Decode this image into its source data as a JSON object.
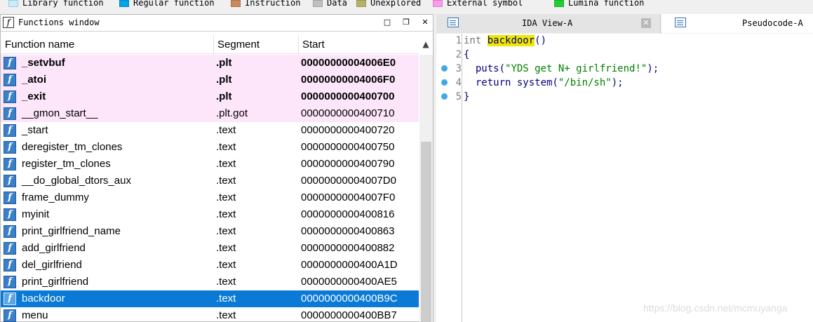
{
  "legend": [
    {
      "label": "Library function",
      "color": "#c8ecfa"
    },
    {
      "label": "Regular function",
      "color": "#00a2e8"
    },
    {
      "label": "Instruction",
      "color": "#c8895e"
    },
    {
      "label": "Data",
      "color": "#c0c0c0"
    },
    {
      "label": "Unexplored",
      "color": "#b4b468"
    },
    {
      "label": "External symbol",
      "color": "#ff99ee"
    },
    {
      "label": "Lumina function",
      "color": "#22cc33"
    }
  ],
  "functions_window": {
    "title": "Functions window",
    "title_icon": "f",
    "columns": {
      "name": "Function name",
      "segment": "Segment",
      "start": "Start"
    },
    "rows": [
      {
        "name": "_setvbuf",
        "segment": ".plt",
        "start": "00000000004006E0",
        "style": "lib bold"
      },
      {
        "name": "_atoi",
        "segment": ".plt",
        "start": "00000000004006F0",
        "style": "lib bold"
      },
      {
        "name": "_exit",
        "segment": ".plt",
        "start": "0000000000400700",
        "style": "lib bold"
      },
      {
        "name": "__gmon_start__",
        "segment": ".plt.got",
        "start": "0000000000400710",
        "style": "lib"
      },
      {
        "name": "_start",
        "segment": ".text",
        "start": "0000000000400720",
        "style": ""
      },
      {
        "name": "deregister_tm_clones",
        "segment": ".text",
        "start": "0000000000400750",
        "style": ""
      },
      {
        "name": "register_tm_clones",
        "segment": ".text",
        "start": "0000000000400790",
        "style": ""
      },
      {
        "name": "__do_global_dtors_aux",
        "segment": ".text",
        "start": "00000000004007D0",
        "style": ""
      },
      {
        "name": "frame_dummy",
        "segment": ".text",
        "start": "00000000004007F0",
        "style": ""
      },
      {
        "name": "myinit",
        "segment": ".text",
        "start": "0000000000400816",
        "style": ""
      },
      {
        "name": "print_girlfriend_name",
        "segment": ".text",
        "start": "0000000000400863",
        "style": ""
      },
      {
        "name": "add_girlfriend",
        "segment": ".text",
        "start": "0000000000400882",
        "style": ""
      },
      {
        "name": "del_girlfriend",
        "segment": ".text",
        "start": "0000000000400A1D",
        "style": ""
      },
      {
        "name": "print_girlfriend",
        "segment": ".text",
        "start": "0000000000400AE5",
        "style": ""
      },
      {
        "name": "backdoor",
        "segment": ".text",
        "start": "0000000000400B9C",
        "style": "sel"
      },
      {
        "name": "menu",
        "segment": ".text",
        "start": "0000000000400BB7",
        "style": ""
      }
    ]
  },
  "tabs": [
    {
      "label": "IDA View-A",
      "close": "✕"
    },
    {
      "label": "Pseudocode-A"
    }
  ],
  "code": {
    "line_numbers": [
      "1",
      "2",
      "3",
      "4",
      "5"
    ],
    "l1_type": "int",
    "l1_name": "backdoor",
    "l1_paren": "()",
    "l2": "{",
    "l3_fn": "  puts(",
    "l3_str": "\"YDS get N+ girlfriend!\"",
    "l3_end": ");",
    "l4_fn": "  return system(",
    "l4_str": "\"/bin/sh\"",
    "l4_end": ");",
    "l5": "}"
  },
  "watermark": "https://blog.csdn.net/mcmuyanga"
}
